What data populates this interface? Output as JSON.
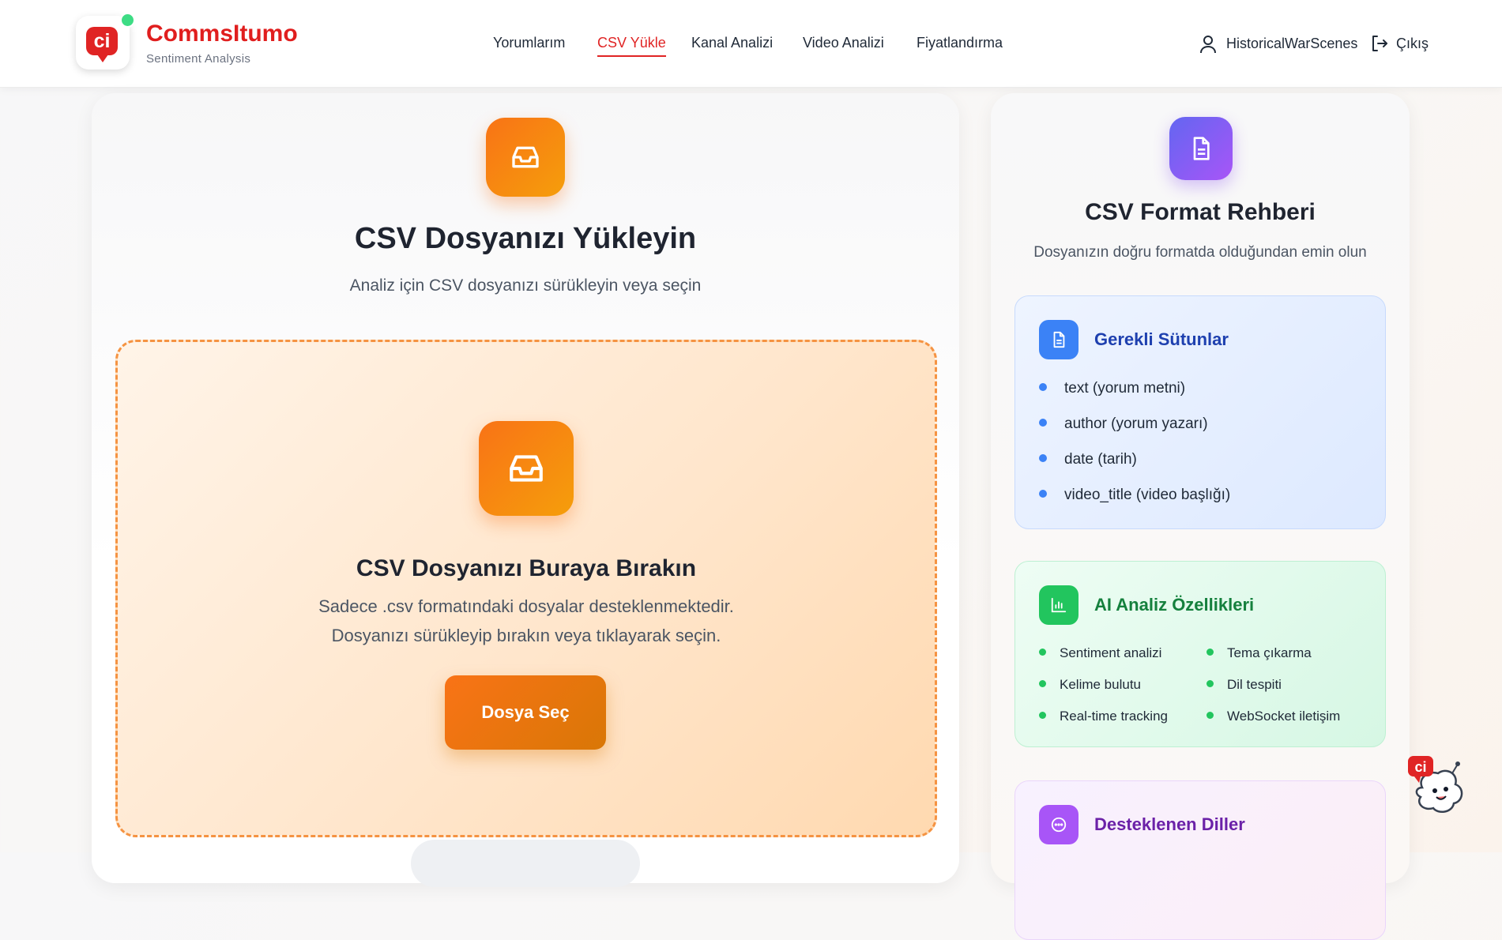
{
  "brand": {
    "name": "CommsItumo",
    "subtitle": "Sentiment Analysis",
    "mark": "ci"
  },
  "nav": {
    "items": [
      {
        "label": "Yorumlarım"
      },
      {
        "label": "CSV Yükle"
      },
      {
        "label": "Kanal Analizi"
      },
      {
        "label": "Video Analizi"
      },
      {
        "label": "Fiyatlandırma"
      }
    ],
    "active": "CSV Yükle"
  },
  "user": {
    "name": "HistoricalWarScenes",
    "logout_label": "Çıkış"
  },
  "upload": {
    "title": "CSV Dosyanızı Yükleyin",
    "subtitle": "Analiz için CSV dosyanızı sürükleyin veya seçin",
    "dropzone": {
      "title": "CSV Dosyanızı Buraya Bırakın",
      "line1": "Sadece .csv formatındaki dosyalar desteklenmektedir.",
      "line2": "Dosyanızı sürükleyip bırakın veya tıklayarak seçin.",
      "button_label": "Dosya Seç"
    }
  },
  "guide": {
    "title": "CSV Format Rehberi",
    "subtitle": "Dosyanızın doğru formatda olduğundan emin olun",
    "required": {
      "title": "Gerekli Sütunlar",
      "items": [
        "text (yorum metni)",
        "author (yorum yazarı)",
        "date (tarih)",
        "video_title (video başlığı)"
      ]
    },
    "features": {
      "title": "AI Analiz Özellikleri",
      "items": [
        "Sentiment analizi",
        "Tema çıkarma",
        "Kelime bulutu",
        "Dil tespiti",
        "Real-time tracking",
        "WebSocket iletişim"
      ]
    },
    "languages": {
      "title": "Desteklenen Diller"
    }
  },
  "colors": {
    "brand_red": "#e02424",
    "accent_orange": "#f97316",
    "blue": "#3b82f6",
    "green": "#22c55e",
    "purple": "#a855f7"
  }
}
